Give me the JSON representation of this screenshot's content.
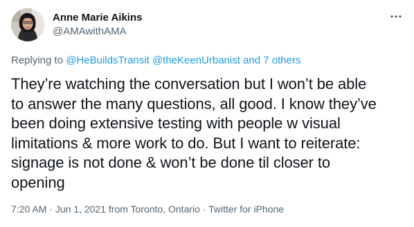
{
  "author": {
    "display_name": "Anne Marie Aikins",
    "handle": "@AMAwithAMA"
  },
  "more_icon": "more-horizontal-icon",
  "reply": {
    "prefix": "Replying to",
    "mention_1": "@HeBuildsTransit",
    "mention_2": "@theKeenUrbanist",
    "conjunction": "and",
    "others": "7 others"
  },
  "tweet": {
    "line_1": "They’re watching the conversation but I won’t be able",
    "line_2": "to answer the many questions, all good. I know they’ve",
    "line_3": "been doing extensive testing with people w visual",
    "line_4": "limitations & more work to do. But I want to reiterate:",
    "line_5": "signage is not done & won’t be done til closer to",
    "line_6": "opening"
  },
  "meta": {
    "time": "7:20 AM",
    "separator": "·",
    "date": "Jun 1, 2021",
    "location_prefix": "from",
    "location": "Toronto, Ontario",
    "source": "Twitter for iPhone"
  },
  "colors": {
    "text": "#0f1419",
    "secondary": "#536471",
    "link": "#1d9bf0"
  }
}
